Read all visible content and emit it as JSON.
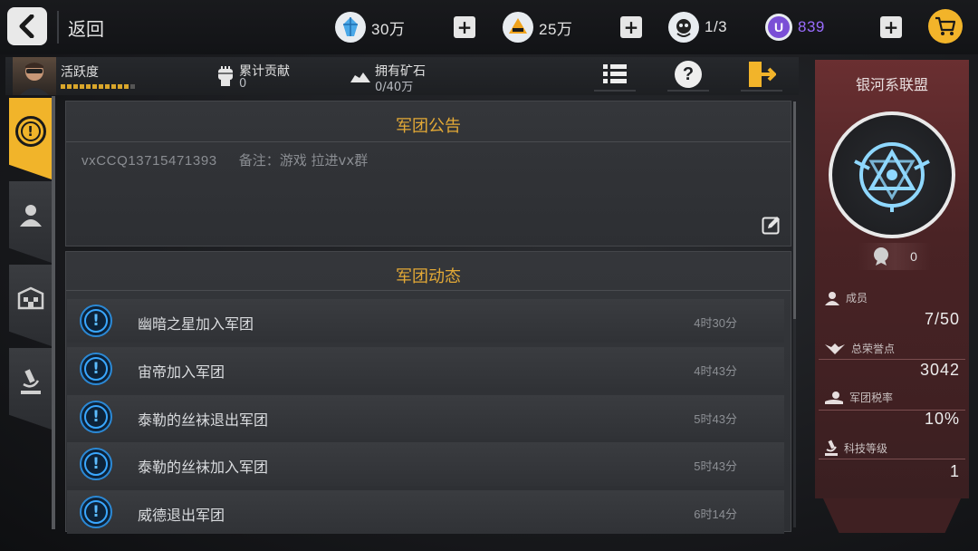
{
  "header": {
    "back_label": "返回",
    "resources": [
      {
        "name": "crystal",
        "value": "30万"
      },
      {
        "name": "gold-bar",
        "value": "25万"
      },
      {
        "name": "energy",
        "value": "1/3"
      },
      {
        "name": "u-coin",
        "value": "839"
      }
    ]
  },
  "infobar": {
    "activity_label": "活跃度",
    "activity_level": 0.85,
    "contribution_label": "累计贡献",
    "contribution_value": "0",
    "ore_label": "拥有矿石",
    "ore_value": "0/40万"
  },
  "announcement": {
    "title": "军团公告",
    "text_id": "vxCCQ13715471393",
    "text_note": "备注：游戏  拉进vx群"
  },
  "activity": {
    "title": "军团动态",
    "items": [
      {
        "text": "幽暗之星加入军团",
        "time": "4时30分"
      },
      {
        "text": "宙帝加入军团",
        "time": "4时43分"
      },
      {
        "text": "泰勒的丝袜退出军团",
        "time": "5时43分"
      },
      {
        "text": "泰勒的丝袜加入军团",
        "time": "5时43分"
      },
      {
        "text": "威德退出军团",
        "time": "6时14分"
      }
    ]
  },
  "legion": {
    "name": "银河系联盟",
    "badge_value": "0",
    "stats": [
      {
        "label": "成员",
        "value": "7/50",
        "icon": "member-icon"
      },
      {
        "label": "总荣誉点",
        "value": "3042",
        "icon": "wings-icon"
      },
      {
        "label": "军团税率",
        "value": "10%",
        "icon": "tax-icon"
      },
      {
        "label": "科技等级",
        "value": "1",
        "icon": "microscope-icon"
      }
    ]
  },
  "colors": {
    "accent_gold": "#e3a936",
    "active_tab": "#f1b42a",
    "info_blue": "#3aa7ff",
    "legion_panel": "#4a2325",
    "u_coin": "#9a6cff"
  }
}
